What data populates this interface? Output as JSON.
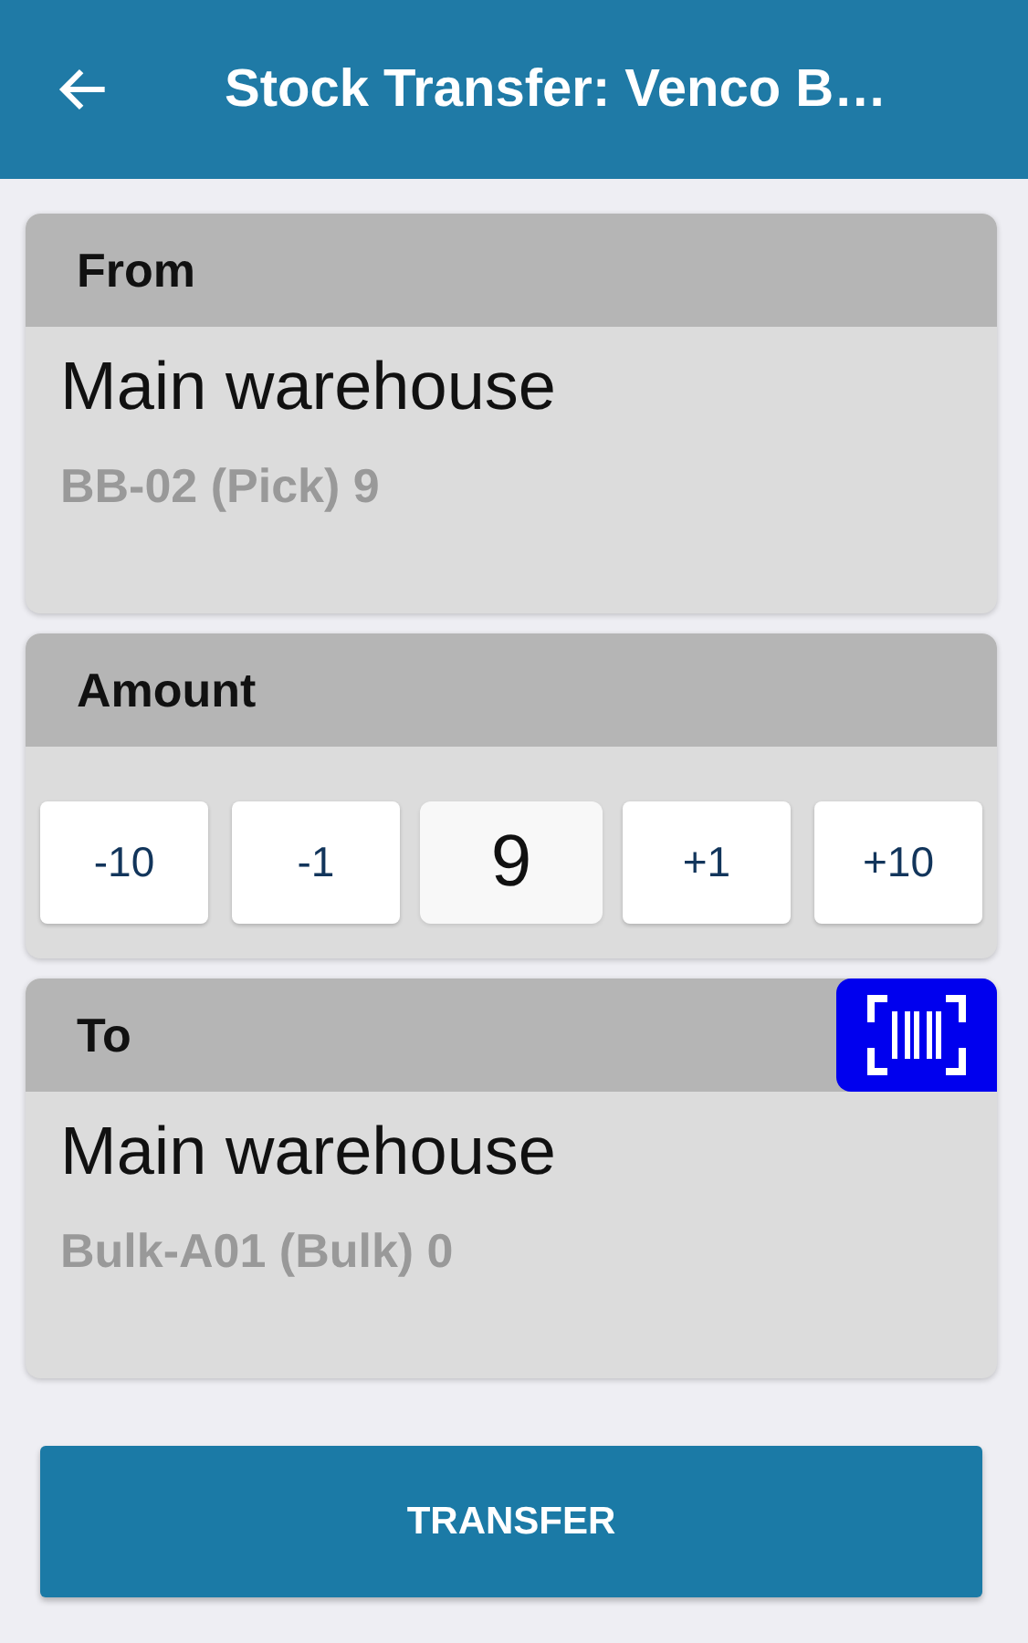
{
  "app_bar": {
    "title": "Stock Transfer: Venco B…"
  },
  "from": {
    "heading": "From",
    "warehouse": "Main warehouse",
    "location": "BB-02 (Pick) 9",
    "scan_button": false
  },
  "amount": {
    "heading": "Amount",
    "steps_down": [
      "-10",
      "-1"
    ],
    "value": "9",
    "steps_up": [
      "+1",
      "+10"
    ]
  },
  "to": {
    "heading": "To",
    "warehouse": "Main warehouse",
    "location": "Bulk-A01 (Bulk) 0",
    "scan_button": true
  },
  "transfer_button": "TRANSFER"
}
